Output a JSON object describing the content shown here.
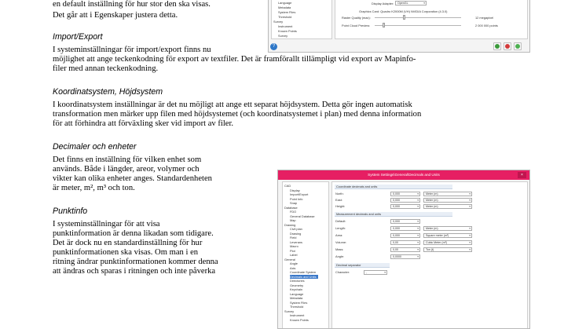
{
  "doc": {
    "intro_line1": "en default inställning för hur stor den ska visas.",
    "intro_line2": "Det går att i Egenskaper justera detta.",
    "import_heading": "Import/Export",
    "import_line1": "I systeminställningar för import/export finns nu",
    "import_line2": "möjlighet att ange teckenkodning för export av textfiler. Det är framförallt tillämpligt vid export av Mapinfo-",
    "import_line3": "filer med annan teckenkodning.",
    "coord_heading": "Koordinatsystem, Höjdsystem",
    "coord_line1": "I koordinatsystem inställningar är det nu möjligt att ange ett separat höjdsystem. Detta gör ingen automatisk",
    "coord_line2": "transformation men märker upp filen med höjdsystemet (och koordinatsystemet i plan) med denna information",
    "coord_line3": "för att förhindra att förväxling sker vid import av filer.",
    "dec_heading": "Decimaler och enheter",
    "dec_line1": "Det finns en inställning för vilken enhet som",
    "dec_line2": "används. Både i längder, areor, volymer och",
    "dec_line3": "vikter kan olika enheter anges. Standardenheten",
    "dec_line4": "är meter, m², m³ och ton.",
    "punkt_heading": "Punktinfo",
    "punkt_line1": "I systeminställningar för att visa",
    "punkt_line2": "punktinformation är denna likadan som tidigare.",
    "punkt_line3": "Det är dock nu en standardinställning för hur",
    "punkt_line4": "punktinformationen ska visas. Om man i en",
    "punkt_line5": "ritning ändrar punktinformationen kommer denna",
    "punkt_line6": "att ändras och sparas i ritningen och inte påverka"
  },
  "window1": {
    "tree_items": [
      "Language",
      "Metadata",
      "System Files",
      "Threshold",
      "Survey",
      "Instrument",
      "Known Points",
      "Survey"
    ],
    "display_adapter_label": "Display Adapter:",
    "display_adapter_value": "OpenGL",
    "graphics_card": "Graphics Card: Quadro K2000M (VH) NVIDIA Corporation (4.3.0)",
    "raster_quality_label": "Raster Quality (max):",
    "raster_quality_value": "12 megapixel",
    "point_cloud_label": "Point Cloud Preview:",
    "point_cloud_value": "2 000 000 points",
    "help_glyph": "?",
    "colors": {
      "ok": "#3a9a3a",
      "cancel": "#d23b3b",
      "apply": "#4caf50"
    }
  },
  "window2": {
    "title": "System Settings\\General\\Decimals and Units",
    "close_glyph": "×",
    "tree_items": [
      "CAD",
      "Display",
      "Import/Export",
      "Point Info",
      "Snap",
      "Database",
      "FDO",
      "General Database",
      "Map",
      "Drawing",
      "Civil plan",
      "Drawing",
      "Field",
      "Leverans",
      "Macro",
      "Plot",
      "Label",
      "General",
      "Angle",
      "Axis",
      "Coordinate System",
      "Decimals and Units",
      "Directories",
      "Geometry",
      "Keychain",
      "Language",
      "Metadata",
      "System Files",
      "Threshold",
      "Survey",
      "Instrument",
      "Known Points"
    ],
    "selected_tree_item": "Decimals and Units",
    "coord_section": "Coordinate decimals and units",
    "coord_rows": [
      {
        "label": "North:",
        "decimals": "0,000",
        "unit": "Meter (m)"
      },
      {
        "label": "East:",
        "decimals": "0,000",
        "unit": "Meter (m)"
      },
      {
        "label": "Height:",
        "decimals": "0,000",
        "unit": "Meter (m)"
      }
    ],
    "meas_section": "Measurement decimals and units",
    "meas_rows": [
      {
        "label": "Default:",
        "decimals": "0,000",
        "unit": ""
      },
      {
        "label": "Length:",
        "decimals": "0,000",
        "unit": "Meter (m)"
      },
      {
        "label": "Area:",
        "decimals": "0,000",
        "unit": "Square meter (m²)"
      },
      {
        "label": "Volume:",
        "decimals": "0,00",
        "unit": "Cubic Meter (m³)"
      },
      {
        "label": "Mass:",
        "decimals": "0,00",
        "unit": "Ton (t)"
      },
      {
        "label": "Angle:",
        "decimals": "0,0000",
        "unit": ""
      }
    ],
    "sep_section": "Decimal separator",
    "sep_label": "Character:",
    "sep_value": ","
  }
}
